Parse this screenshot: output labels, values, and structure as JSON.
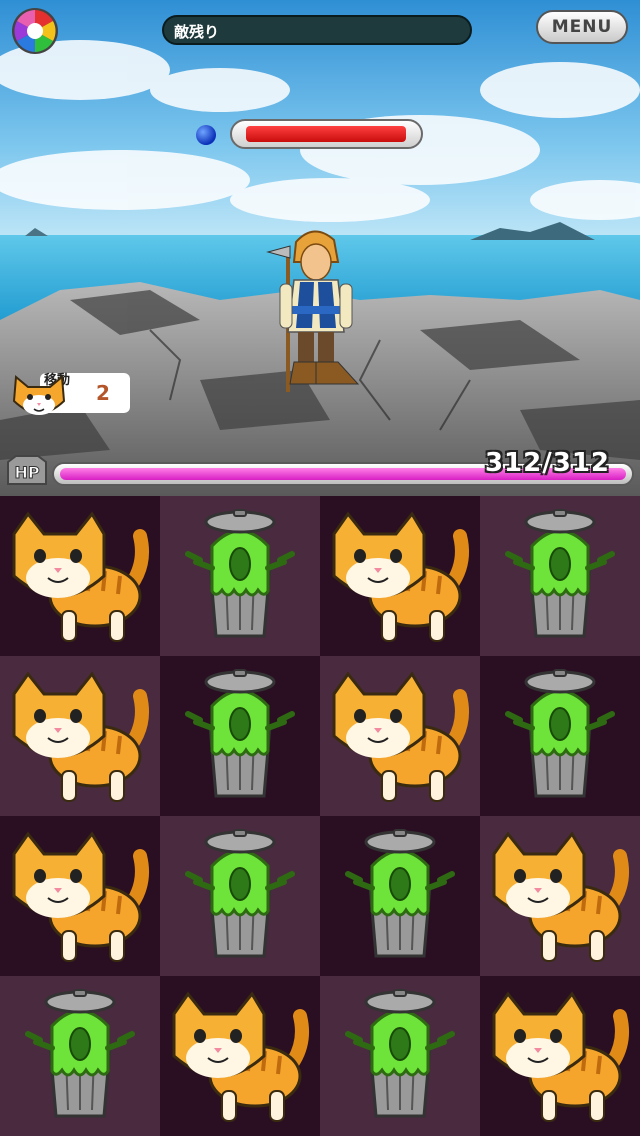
{
  "hud": {
    "enemies_remaining_label": "敵残り",
    "menu_label": "MENU"
  },
  "enemy": {
    "name_icon": "blue-gem",
    "hp_fraction": 1.0
  },
  "moves": {
    "label": "移動",
    "count": "2"
  },
  "player": {
    "hp_label": "HP",
    "hp_text": "312/312",
    "hp_fraction": 1.0
  },
  "board": {
    "rows": [
      [
        "cat",
        "trash",
        "cat",
        "trash"
      ],
      [
        "cat",
        "trash",
        "cat",
        "trash"
      ],
      [
        "cat",
        "trash",
        "trash",
        "cat"
      ],
      [
        "trash",
        "cat",
        "trash",
        "cat"
      ]
    ]
  },
  "colors": {
    "player_hp": "#e030c8",
    "enemy_hp": "#e01a1a",
    "cell_dark": "#2a0f22",
    "cell_light": "#4a2a3f"
  }
}
